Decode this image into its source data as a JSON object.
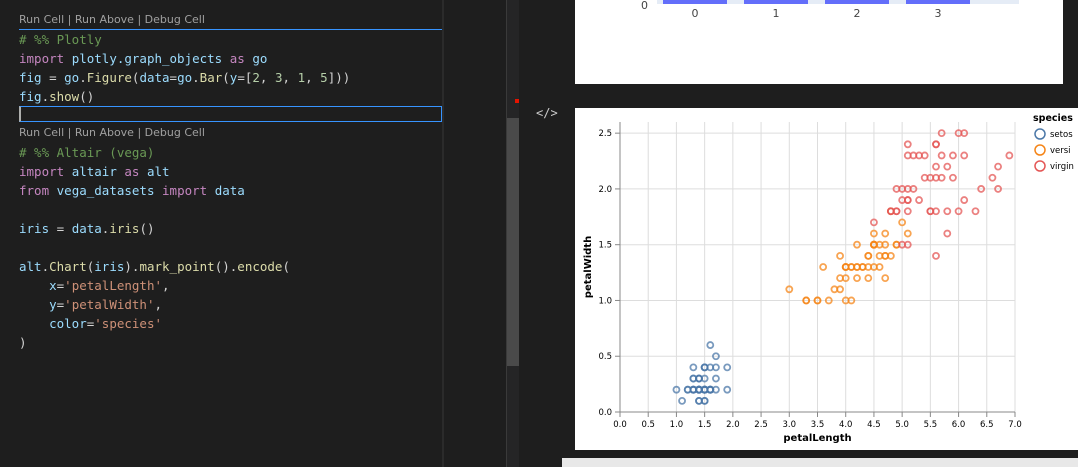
{
  "editor": {
    "codelens": "Run Cell | Run Above | Debug Cell",
    "cell1": {
      "comment": "# %% Plotly",
      "import_kw": "import",
      "import_mod": "plotly.graph_objects",
      "as_kw": "as",
      "alias": "go",
      "l3_var": "fig",
      "l3_eq": " = ",
      "l3_mod": "go",
      "l3_fn": "Figure",
      "l3_open": "(",
      "l3_kw": "data",
      "l3_eq2": "=",
      "l3_mod2": "go",
      "l3_fn2": "Bar",
      "l3_open2": "(",
      "l3_kw2": "y",
      "l3_eq3": "=[",
      "l3_n1": "2",
      "l3_c1": ", ",
      "l3_n2": "3",
      "l3_c2": ", ",
      "l3_n3": "1",
      "l3_c3": ", ",
      "l3_n4": "5",
      "l3_close": "]))",
      "l4_var": "fig",
      "l4_fn": "show",
      "l4_par": "()"
    },
    "cell2": {
      "comment": "# %% Altair (vega)",
      "import_kw": "import",
      "import_mod": "altair",
      "as_kw": "as",
      "alias": "alt",
      "from_kw": "from",
      "from_mod": "vega_datasets",
      "from_import": "import",
      "from_name": "data",
      "iris_var": "iris",
      "iris_eq": " = ",
      "iris_mod": "data",
      "iris_fn": "iris",
      "iris_par": "()",
      "chart_mod": "alt",
      "chart_fn": "Chart",
      "chart_open": "(",
      "chart_arg": "iris",
      "chart_close": ").",
      "mark_fn": "mark_point",
      "mark_par": "().",
      "enc_fn": "encode",
      "enc_open": "(",
      "x_kw": "x",
      "x_val": "'petalLength'",
      "y_kw": "y",
      "y_val": "'petalWidth'",
      "c_kw": "color",
      "c_val": "'species'",
      "close": ")"
    }
  },
  "plotly": {
    "y_tick_zero": "0",
    "categories": [
      "0",
      "1",
      "2",
      "3"
    ],
    "bar_color": "#636efa"
  },
  "altair_code_icon": "</>",
  "chart_data": {
    "type": "scatter",
    "xlabel": "petalLength",
    "ylabel": "petalWidth",
    "xlim": [
      0,
      7
    ],
    "ylim": [
      0,
      2.6
    ],
    "grid": true,
    "legend_position": "right",
    "legend_title": "species",
    "x_ticks": [
      "0.0",
      "0.5",
      "1.0",
      "1.5",
      "2.0",
      "2.5",
      "3.0",
      "3.5",
      "4.0",
      "4.5",
      "5.0",
      "5.5",
      "6.0",
      "6.5",
      "7.0"
    ],
    "y_ticks": [
      "0.0",
      "0.5",
      "1.0",
      "1.5",
      "2.0",
      "2.5"
    ],
    "series": [
      {
        "name": "setosa",
        "color": "#4c78a8",
        "label": "setos",
        "points": [
          [
            1.4,
            0.2
          ],
          [
            1.4,
            0.2
          ],
          [
            1.3,
            0.2
          ],
          [
            1.5,
            0.2
          ],
          [
            1.4,
            0.2
          ],
          [
            1.7,
            0.4
          ],
          [
            1.4,
            0.3
          ],
          [
            1.5,
            0.2
          ],
          [
            1.4,
            0.2
          ],
          [
            1.5,
            0.1
          ],
          [
            1.5,
            0.2
          ],
          [
            1.6,
            0.2
          ],
          [
            1.4,
            0.1
          ],
          [
            1.1,
            0.1
          ],
          [
            1.2,
            0.2
          ],
          [
            1.5,
            0.4
          ],
          [
            1.3,
            0.4
          ],
          [
            1.4,
            0.3
          ],
          [
            1.7,
            0.3
          ],
          [
            1.5,
            0.3
          ],
          [
            1.7,
            0.2
          ],
          [
            1.5,
            0.4
          ],
          [
            1.0,
            0.2
          ],
          [
            1.7,
            0.5
          ],
          [
            1.9,
            0.2
          ],
          [
            1.6,
            0.2
          ],
          [
            1.6,
            0.4
          ],
          [
            1.5,
            0.2
          ],
          [
            1.4,
            0.2
          ],
          [
            1.6,
            0.2
          ],
          [
            1.6,
            0.2
          ],
          [
            1.5,
            0.4
          ],
          [
            1.5,
            0.1
          ],
          [
            1.4,
            0.2
          ],
          [
            1.5,
            0.2
          ],
          [
            1.2,
            0.2
          ],
          [
            1.3,
            0.2
          ],
          [
            1.4,
            0.1
          ],
          [
            1.3,
            0.2
          ],
          [
            1.5,
            0.2
          ],
          [
            1.3,
            0.3
          ],
          [
            1.3,
            0.3
          ],
          [
            1.3,
            0.2
          ],
          [
            1.6,
            0.6
          ],
          [
            1.9,
            0.4
          ],
          [
            1.4,
            0.3
          ],
          [
            1.6,
            0.2
          ],
          [
            1.4,
            0.2
          ],
          [
            1.5,
            0.2
          ],
          [
            1.4,
            0.2
          ]
        ]
      },
      {
        "name": "versicolor",
        "color": "#f58518",
        "label": "versi",
        "points": [
          [
            4.7,
            1.4
          ],
          [
            4.5,
            1.5
          ],
          [
            4.9,
            1.5
          ],
          [
            4.0,
            1.3
          ],
          [
            4.6,
            1.5
          ],
          [
            4.5,
            1.3
          ],
          [
            4.7,
            1.6
          ],
          [
            3.3,
            1.0
          ],
          [
            4.6,
            1.3
          ],
          [
            3.9,
            1.4
          ],
          [
            3.5,
            1.0
          ],
          [
            4.2,
            1.5
          ],
          [
            4.0,
            1.0
          ],
          [
            4.7,
            1.4
          ],
          [
            3.6,
            1.3
          ],
          [
            4.4,
            1.4
          ],
          [
            4.5,
            1.5
          ],
          [
            4.1,
            1.0
          ],
          [
            4.5,
            1.5
          ],
          [
            3.9,
            1.1
          ],
          [
            4.8,
            1.8
          ],
          [
            4.0,
            1.3
          ],
          [
            4.9,
            1.5
          ],
          [
            4.7,
            1.2
          ],
          [
            4.3,
            1.3
          ],
          [
            4.4,
            1.4
          ],
          [
            4.8,
            1.4
          ],
          [
            5.0,
            1.7
          ],
          [
            4.5,
            1.5
          ],
          [
            3.5,
            1.0
          ],
          [
            3.8,
            1.1
          ],
          [
            3.7,
            1.0
          ],
          [
            3.9,
            1.2
          ],
          [
            5.1,
            1.6
          ],
          [
            4.5,
            1.5
          ],
          [
            4.5,
            1.6
          ],
          [
            4.7,
            1.5
          ],
          [
            4.4,
            1.3
          ],
          [
            4.1,
            1.3
          ],
          [
            4.0,
            1.3
          ],
          [
            4.4,
            1.2
          ],
          [
            4.6,
            1.4
          ],
          [
            4.0,
            1.2
          ],
          [
            3.3,
            1.0
          ],
          [
            4.2,
            1.3
          ],
          [
            4.2,
            1.2
          ],
          [
            4.2,
            1.3
          ],
          [
            4.3,
            1.3
          ],
          [
            3.0,
            1.1
          ],
          [
            4.1,
            1.3
          ]
        ]
      },
      {
        "name": "virginica",
        "color": "#e45756",
        "label": "virgin",
        "points": [
          [
            6.0,
            2.5
          ],
          [
            5.1,
            1.9
          ],
          [
            5.9,
            2.1
          ],
          [
            5.6,
            1.8
          ],
          [
            5.8,
            2.2
          ],
          [
            6.6,
            2.1
          ],
          [
            4.5,
            1.7
          ],
          [
            6.3,
            1.8
          ],
          [
            5.8,
            1.8
          ],
          [
            6.1,
            2.5
          ],
          [
            5.1,
            2.0
          ],
          [
            5.3,
            1.9
          ],
          [
            5.5,
            2.1
          ],
          [
            5.0,
            2.0
          ],
          [
            5.1,
            2.4
          ],
          [
            5.3,
            2.3
          ],
          [
            5.5,
            1.8
          ],
          [
            6.7,
            2.2
          ],
          [
            6.9,
            2.3
          ],
          [
            5.0,
            1.5
          ],
          [
            5.7,
            2.3
          ],
          [
            4.9,
            2.0
          ],
          [
            6.7,
            2.0
          ],
          [
            4.9,
            1.8
          ],
          [
            5.7,
            2.1
          ],
          [
            6.0,
            1.8
          ],
          [
            4.8,
            1.8
          ],
          [
            4.9,
            1.8
          ],
          [
            5.6,
            2.1
          ],
          [
            5.8,
            1.6
          ],
          [
            6.1,
            1.9
          ],
          [
            6.4,
            2.0
          ],
          [
            5.6,
            2.2
          ],
          [
            5.1,
            1.5
          ],
          [
            5.6,
            1.4
          ],
          [
            6.1,
            2.3
          ],
          [
            5.6,
            2.4
          ],
          [
            5.5,
            1.8
          ],
          [
            4.8,
            1.8
          ],
          [
            5.4,
            2.1
          ],
          [
            5.6,
            2.4
          ],
          [
            5.1,
            2.3
          ],
          [
            5.1,
            1.9
          ],
          [
            5.9,
            2.3
          ],
          [
            5.7,
            2.5
          ],
          [
            5.2,
            2.3
          ],
          [
            5.0,
            1.9
          ],
          [
            5.2,
            2.0
          ],
          [
            5.4,
            2.3
          ],
          [
            5.1,
            1.8
          ]
        ]
      }
    ]
  }
}
